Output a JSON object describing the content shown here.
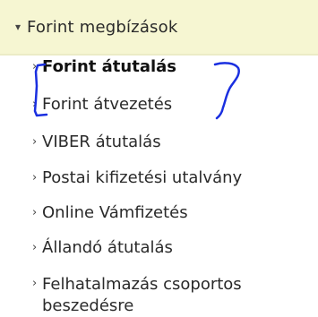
{
  "section": {
    "title": "Forint megbízások",
    "caret_icon": "chevron-down-icon"
  },
  "menu": {
    "items": [
      {
        "label": "Forint átutalás",
        "active": true
      },
      {
        "label": "Forint átvezetés",
        "active": false
      },
      {
        "label": "VIBER átutalás",
        "active": false
      },
      {
        "label": "Postai kifizetési utalvány",
        "active": false
      },
      {
        "label": "Online Vámfizetés",
        "active": false
      },
      {
        "label": "Állandó átutalás",
        "active": false
      },
      {
        "label": "Felhatalmazás csoportos beszedésre",
        "active": false
      }
    ]
  },
  "colors": {
    "header_background": "#f6f6d2",
    "annotation_ink": "#1a2fe0"
  }
}
